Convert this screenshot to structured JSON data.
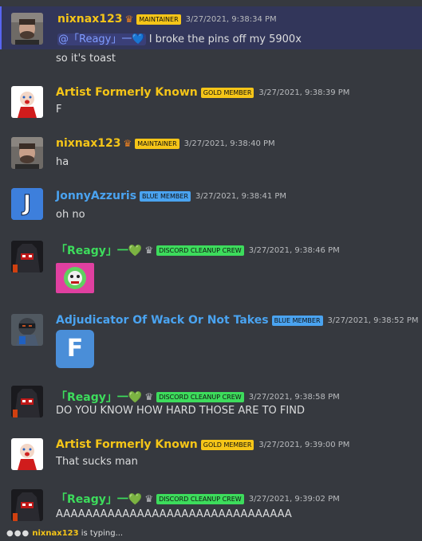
{
  "colors": {
    "background": "#36393f",
    "maintainer": "#f5c518",
    "gold_member": "#f5c518",
    "blue_member": "#4aa3f0",
    "cleanup_crew": "#3ddc5c",
    "mention": "#7f9cff"
  },
  "messages": [
    {
      "username": "nixnax123",
      "badge": "MAINTAINER",
      "timestamp": "3/27/2021, 9:38:34 PM",
      "mention": "@「Reagy」一💙",
      "text": "I broke the pins off my 5900x",
      "text2": "so it's toast"
    },
    {
      "username": "Artist Formerly Known",
      "badge": "GOLD MEMBER",
      "timestamp": "3/27/2021, 9:38:39 PM",
      "text": "F"
    },
    {
      "username": "nixnax123",
      "badge": "MAINTAINER",
      "timestamp": "3/27/2021, 9:38:40 PM",
      "text": "ha"
    },
    {
      "username": "JonnyAzzuris",
      "badge": "BLUE MEMBER",
      "timestamp": "3/27/2021, 9:38:41 PM",
      "text": "oh no",
      "avatar_letter": "J"
    },
    {
      "username": "「Reagy」一💚",
      "badge": "DISCORD CLEANUP CREW",
      "timestamp": "3/27/2021, 9:38:46 PM"
    },
    {
      "username": "Adjudicator Of Wack Or Not Takes",
      "badge": "BLUE MEMBER",
      "timestamp": "3/27/2021, 9:38:52 PM",
      "emoji_letter": "F"
    },
    {
      "username": "「Reagy」一💚",
      "badge": "DISCORD CLEANUP CREW",
      "timestamp": "3/27/2021, 9:38:58 PM",
      "text": "DO YOU KNOW HOW HARD THOSE ARE TO FIND"
    },
    {
      "username": "Artist Formerly Known",
      "badge": "GOLD MEMBER",
      "timestamp": "3/27/2021, 9:39:00 PM",
      "text": "That sucks man"
    },
    {
      "username": "「Reagy」一💚",
      "badge": "DISCORD CLEANUP CREW",
      "timestamp": "3/27/2021, 9:39:02 PM",
      "text": "AAAAAAAAAAAAAAAAAAAAAAAAAAAAAAAA"
    }
  ],
  "typing": {
    "user": "nixnax123",
    "suffix": " is typing..."
  }
}
